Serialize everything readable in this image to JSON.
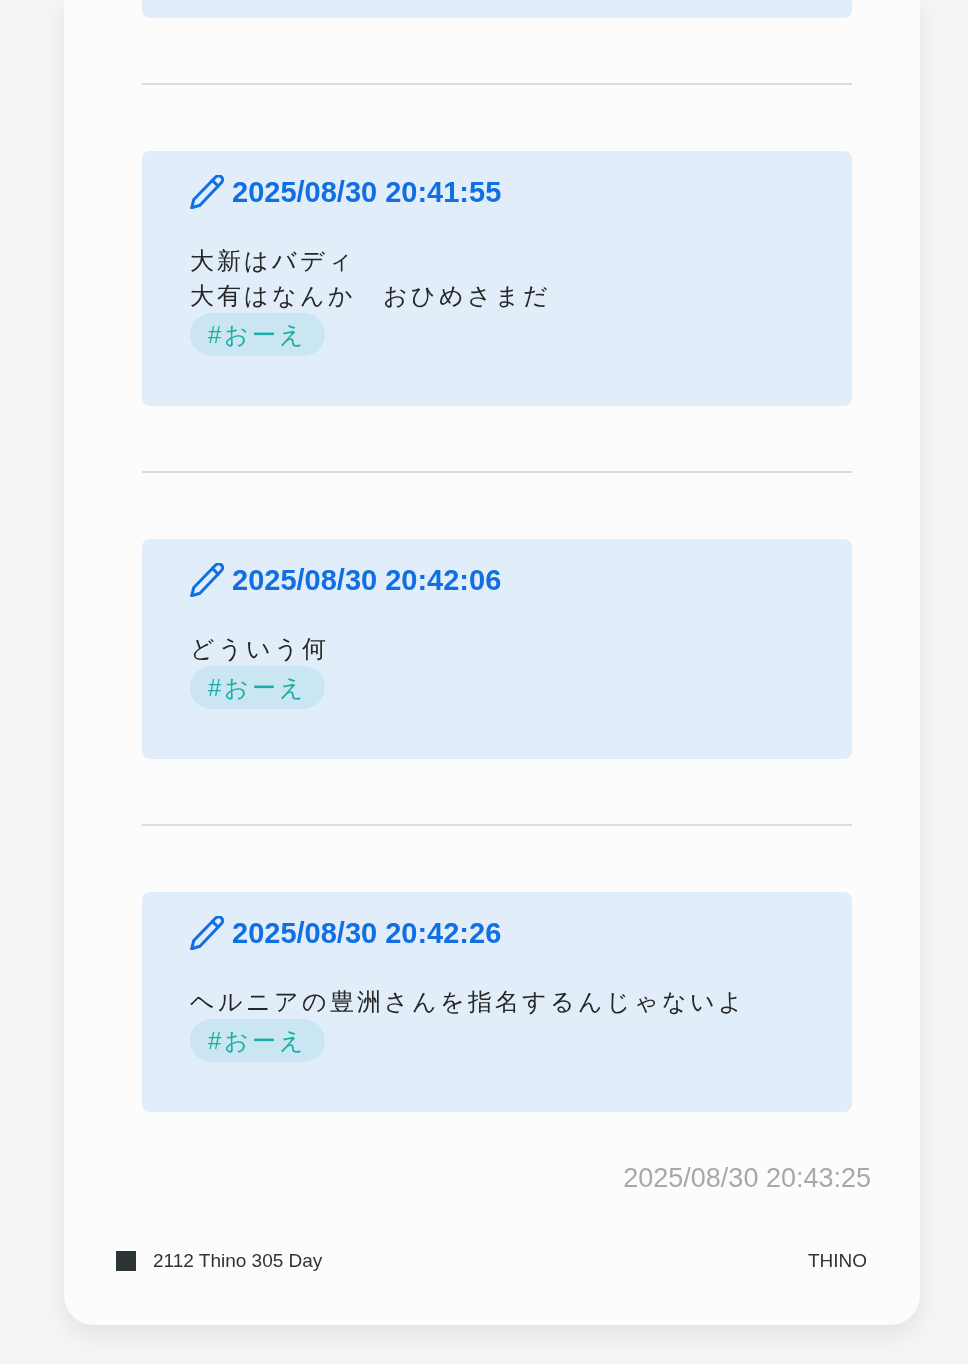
{
  "memos": [
    {
      "time": "2025/08/30 20:41:55",
      "lines": [
        "大新はバディ",
        "大有はなんか　おひめさまだ"
      ],
      "tags": [
        "#おーえ"
      ]
    },
    {
      "time": "2025/08/30 20:42:06",
      "lines": [
        "どういう何"
      ],
      "tags": [
        "#おーえ"
      ]
    },
    {
      "time": "2025/08/30 20:42:26",
      "lines": [
        "ヘルニアの豊洲さんを指名するんじゃないよ"
      ],
      "tags": [
        "#おーえ"
      ]
    }
  ],
  "export_time": "2025/08/30 20:43:25",
  "footer": {
    "title": "2112 Thino 305 Day",
    "brand": "THINO"
  }
}
